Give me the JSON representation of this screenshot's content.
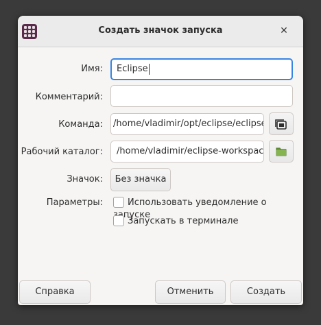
{
  "window": {
    "title": "Создать значок запуска",
    "close_glyph": "✕"
  },
  "form": {
    "name_label": "Имя:",
    "name_value": "Eclipse",
    "comment_label": "Комментарий:",
    "comment_value": "",
    "command_label": "Команда:",
    "command_value": "/home/vladimir/opt/eclipse/eclipse",
    "workdir_label": "Рабочий каталог:",
    "workdir_value": "/home/vladimir/eclipse-workspace",
    "icon_label": "Значок:",
    "icon_button": "Без значка",
    "options_label": "Параметры:",
    "option_notify": "Использовать уведомление о запуске",
    "option_notify_checked": false,
    "option_terminal": "Запускать в терминале",
    "option_terminal_checked": false
  },
  "buttons": {
    "help": "Справка",
    "cancel": "Отменить",
    "create": "Создать"
  },
  "icons": {
    "app": "app-grid-icon",
    "command_browse": "copy-browse-icon",
    "workdir_browse": "folder-icon"
  },
  "colors": {
    "focus": "#3584e4",
    "app_icon_bg": "#5a2a4a",
    "folder_green": "#6a9a3a"
  }
}
